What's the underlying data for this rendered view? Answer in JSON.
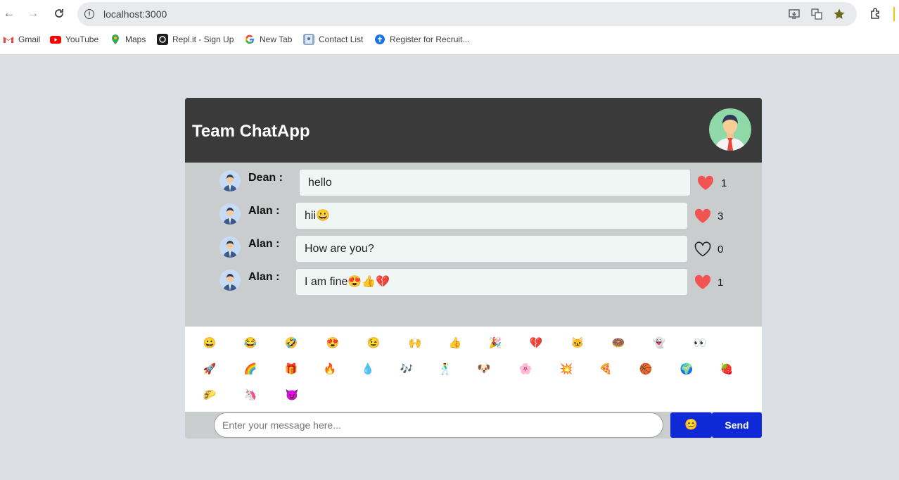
{
  "browser": {
    "url": "localhost:3000",
    "bookmarks": [
      {
        "label": "Gmail",
        "icon": "gmail-icon"
      },
      {
        "label": "YouTube",
        "icon": "youtube-icon"
      },
      {
        "label": "Maps",
        "icon": "maps-icon"
      },
      {
        "label": "Repl.it - Sign Up",
        "icon": "replit-icon"
      },
      {
        "label": "New Tab",
        "icon": "google-icon"
      },
      {
        "label": "Contact List",
        "icon": "contact-list-icon"
      },
      {
        "label": "Register for Recruit...",
        "icon": "globe-icon"
      }
    ]
  },
  "chat": {
    "title": "Team ChatApp",
    "messages": [
      {
        "user": "Dean :",
        "text": "hello",
        "likes": "1",
        "liked": true
      },
      {
        "user": "Alan :",
        "text": "hii😀",
        "likes": "3",
        "liked": true
      },
      {
        "user": "Alan :",
        "text": "How are you?",
        "likes": "0",
        "liked": false
      },
      {
        "user": "Alan :",
        "text": "I am fine😍👍💔",
        "likes": "1",
        "liked": true
      }
    ],
    "emojis": [
      "😀",
      "😂",
      "🤣",
      "😍",
      "😉",
      "🙌",
      "👍",
      "🎉",
      "💔",
      "🐱",
      "🍩",
      "👻",
      "👀",
      "🚀",
      "🌈",
      "🎁",
      "🔥",
      "💧",
      "🎶",
      "🕺",
      "🐶",
      "🌸",
      "💥",
      "🍕",
      "🏀",
      "🌍",
      "🍓",
      "🌮",
      "🦄",
      "😈"
    ],
    "input_placeholder": "Enter your message here...",
    "emoji_button": "😊",
    "send_label": "Send"
  },
  "colors": {
    "header": "#3a3a3a",
    "chat_bg": "#c9cdcd",
    "bubble": "#eff6f4",
    "heart": "#f25454",
    "button": "#1029d6"
  }
}
